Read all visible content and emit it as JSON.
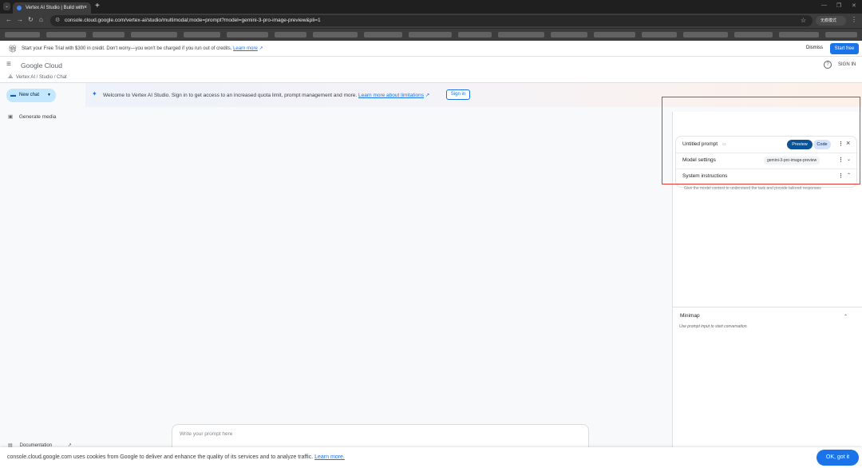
{
  "browser": {
    "tab_title": "Vertex AI Studio | Build with",
    "tab_close": "×",
    "new_tab": "+",
    "url": "console.cloud.google.com/vertex-ai/studio/multimodal;mode=prompt?model=gemini-3-pro-image-preview&pli=1",
    "profile_label": "无痕模式"
  },
  "trial_banner": {
    "message": "Start your Free Trial with $300 in credit. Don't worry—you won't be charged if you run out of credits.",
    "learn_more": "Learn more",
    "dismiss": "Dismiss",
    "start_free": "Start free"
  },
  "header": {
    "logo": "Google Cloud",
    "sign_in": "SIGN IN",
    "help": "?"
  },
  "breadcrumb": {
    "text": "Vertex AI / Studio / Chat"
  },
  "sidebar": {
    "new_chat": "New chat",
    "generate_media": "Generate media",
    "documentation": "Documentation"
  },
  "welcome": {
    "message": "Welcome to Vertex AI Studio. Sign in to get access to an increased quota limit, prompt management and more.",
    "learn_more": "Learn more about limitations",
    "sign_in": "Sign in"
  },
  "prompt": {
    "placeholder": "Write your prompt here"
  },
  "right_panel": {
    "untitled": "Untitled prompt",
    "preview": "Preview",
    "code": "Code",
    "model_settings": "Model settings",
    "model_name": "gemini-3-pro-image-preview",
    "system_instructions": "System instructions",
    "system_hint": "Give the model context to understand the task and provide tailored responses",
    "minimap_title": "Minimap",
    "minimap_hint": "Use prompt input to start conversation."
  },
  "cookie": {
    "message": "console.cloud.google.com uses cookies from Google to deliver and enhance the quality of its services and to analyze traffic.",
    "learn_more": "Learn more.",
    "ok": "OK, got it"
  },
  "colors": {
    "accent": "#1a73e8",
    "preview_button": "#0b5394",
    "highlight_box": "#e53935"
  }
}
